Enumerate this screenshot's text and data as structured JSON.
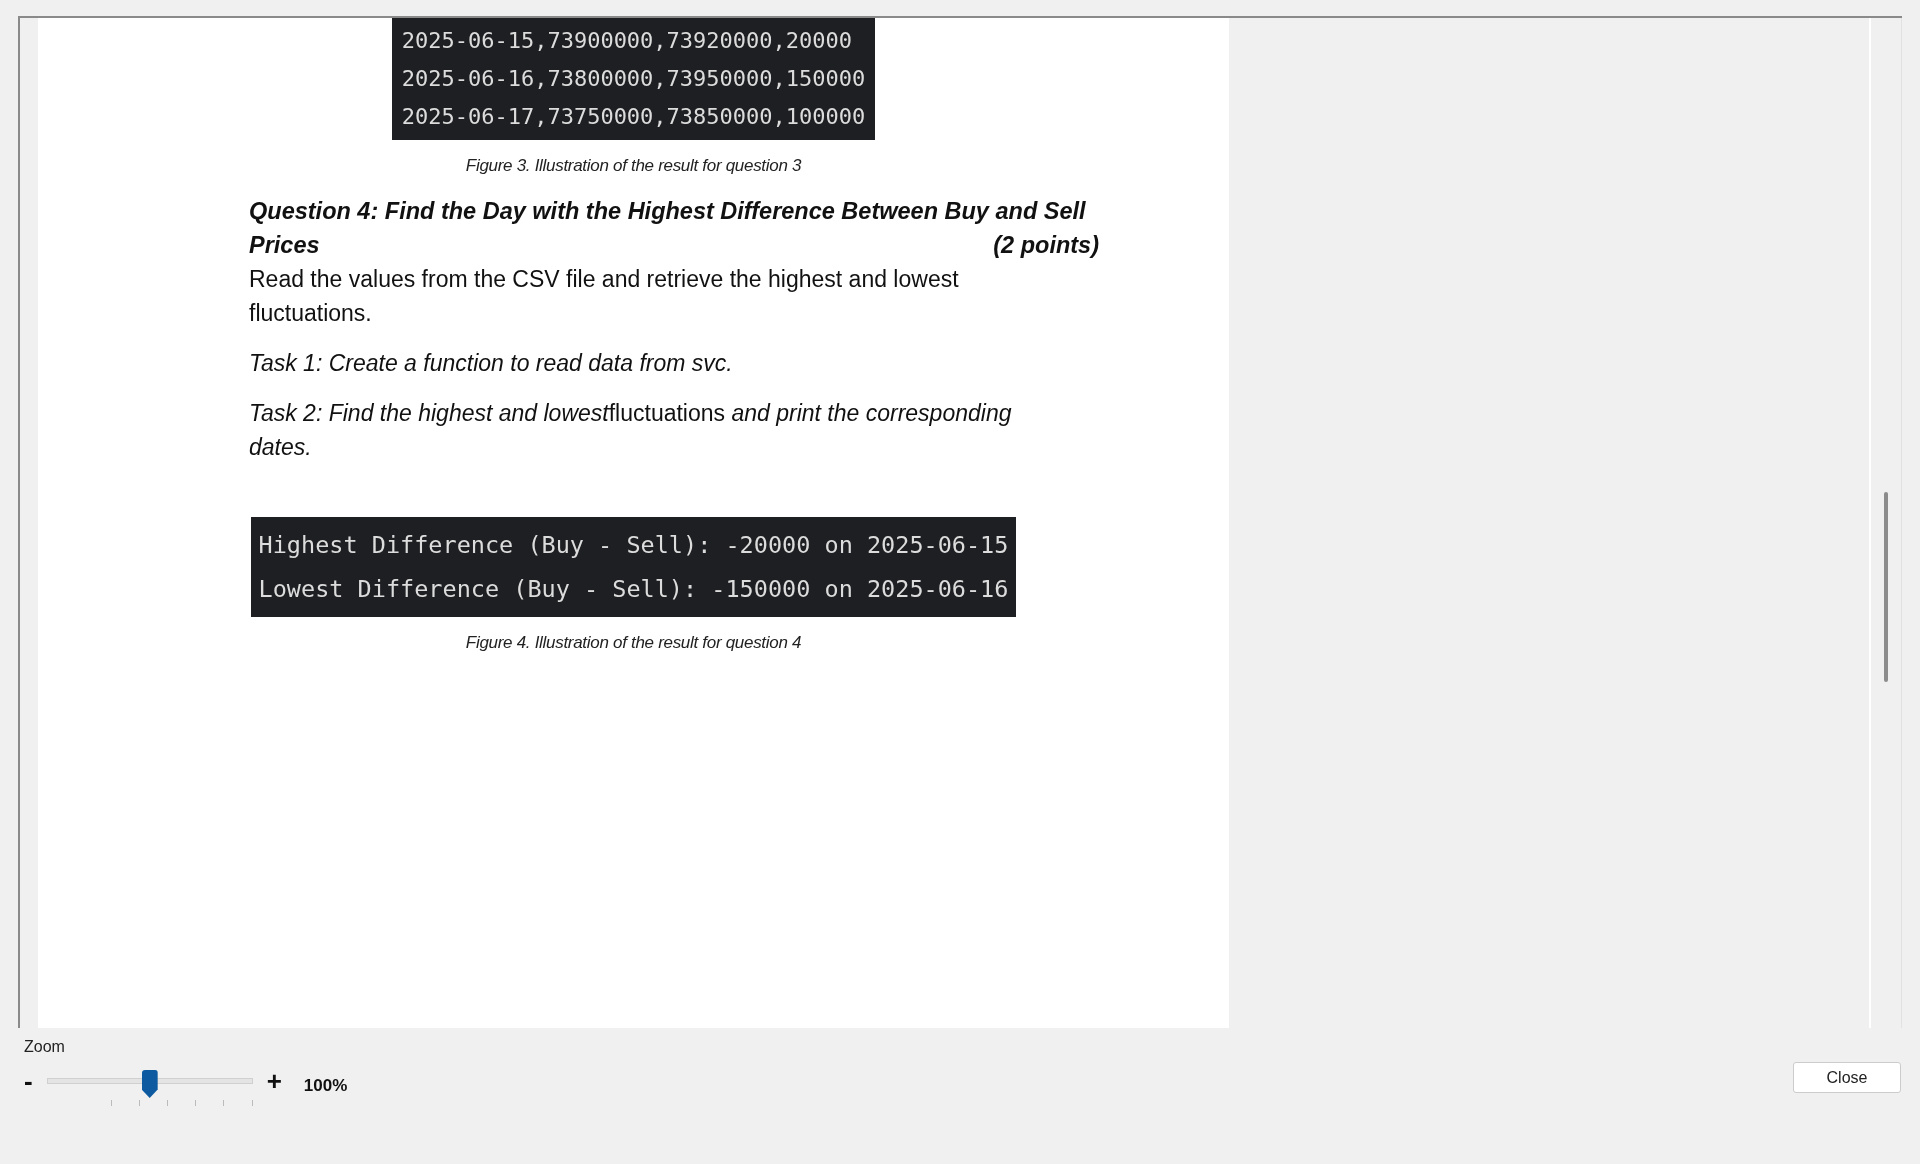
{
  "document": {
    "blocks": [
      {
        "kind": "code",
        "lines": [
          "2025-06-15,73900000,73920000,20000",
          "2025-06-16,73800000,73950000,150000",
          "2025-06-17,73750000,73850000,100000"
        ]
      },
      {
        "kind": "caption",
        "text": "Figure 3. Illustration of the result for question 3"
      },
      {
        "kind": "heading",
        "text": "Question 4: Find the Day with the Highest Difference Between Buy and Sell Prices",
        "points": "(2 points)"
      },
      {
        "kind": "paragraph",
        "text": "Read the values from the CSV file and retrieve the highest and lowest fluctuations."
      },
      {
        "kind": "task",
        "text": "*Task 1: Create a function to read data from svc.*"
      },
      {
        "kind": "task_parts",
        "parts": [
          {
            "text": "Task 2: Find the highest and lowest",
            "italic": true
          },
          {
            "text": "fluctuations",
            "italic": false
          },
          {
            "text": " and print the corresponding dates.",
            "italic": true
          }
        ]
      },
      {
        "kind": "code",
        "lines": [
          "Highest Difference (Buy - Sell): -20000 on 2025-06-15",
          "Lowest Difference (Buy - Sell): -150000 on 2025-06-16"
        ]
      },
      {
        "kind": "caption",
        "text": "Figure 4. Illustration of the result for question 4"
      }
    ]
  },
  "zoom": {
    "label": "Zoom",
    "minus": "-",
    "plus": "+",
    "level": 0.5,
    "reading": "100%"
  },
  "buttons": [
    {
      "label": "Close"
    }
  ]
}
